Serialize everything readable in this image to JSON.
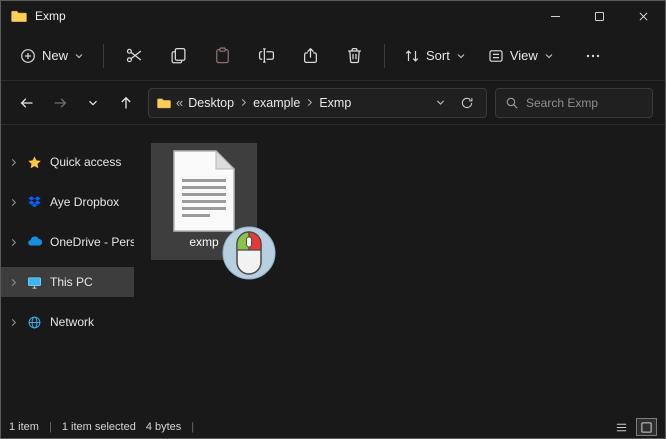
{
  "titlebar": {
    "title": "Exmp"
  },
  "toolbar": {
    "new_label": "New",
    "sort_label": "Sort",
    "view_label": "View"
  },
  "navbar": {
    "collapse": "«",
    "crumbs": [
      "Desktop",
      "example",
      "Exmp"
    ],
    "search_placeholder": "Search Exmp"
  },
  "sidebar": {
    "items": [
      {
        "label": "Quick access"
      },
      {
        "label": "Aye Dropbox"
      },
      {
        "label": "OneDrive - Pers"
      },
      {
        "label": "This PC"
      },
      {
        "label": "Network"
      }
    ]
  },
  "main": {
    "file_name": "exmp"
  },
  "statusbar": {
    "items_count": "1 item",
    "selected": "1 item selected",
    "size": "4 bytes",
    "divider": "|"
  },
  "colors": {
    "window_bg": "#191919",
    "selection_bg": "#3e3e3e",
    "quick_access_star": "#ffc83d",
    "dropbox_blue": "#0062ff",
    "onedrive_blue": "#1490df",
    "pc_screen_blue": "#38b6f1",
    "mouse_circle": "#b7cfdf",
    "mouse_left_button": "#8bc34a",
    "mouse_right_button": "#e53935"
  }
}
